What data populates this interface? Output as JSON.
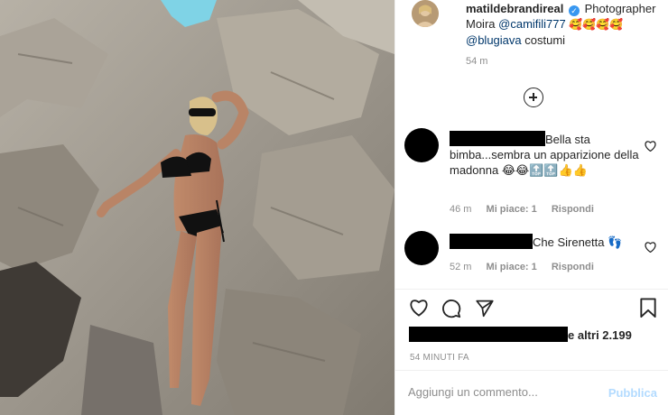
{
  "post": {
    "username": "matildebrandireal",
    "verified_icon": "verified-badge-icon",
    "caption": {
      "word1": "Photographer",
      "line2_prefix": "Moira",
      "mention1": "@camifili777",
      "emojis1": "🥰🥰🥰🥰",
      "mention2": "@blugiava",
      "suffix": "costumi"
    },
    "time": "54 m"
  },
  "load_more_icon": "plus-circle-icon",
  "comments": [
    {
      "text": "Bella sta bimba...sembra un apparizione della madonna 😂😂🔝🔝👍👍",
      "time": "46 m",
      "likes": "Mi piace: 1",
      "reply": "Rispondi"
    },
    {
      "text": "Che Sirenetta 👣",
      "time": "52 m",
      "likes": "Mi piace: 1",
      "reply": "Rispondi"
    }
  ],
  "likes": {
    "text": "e altri 2.199"
  },
  "timestamp": "54 MINUTI FA",
  "comment_box": {
    "placeholder": "Aggiungi un commento...",
    "publish": "Pubblica"
  },
  "colors": {
    "link": "#00376b",
    "muted": "#8e8e8e",
    "publish_disabled": "#b3dbff",
    "verified": "#3897f0"
  }
}
